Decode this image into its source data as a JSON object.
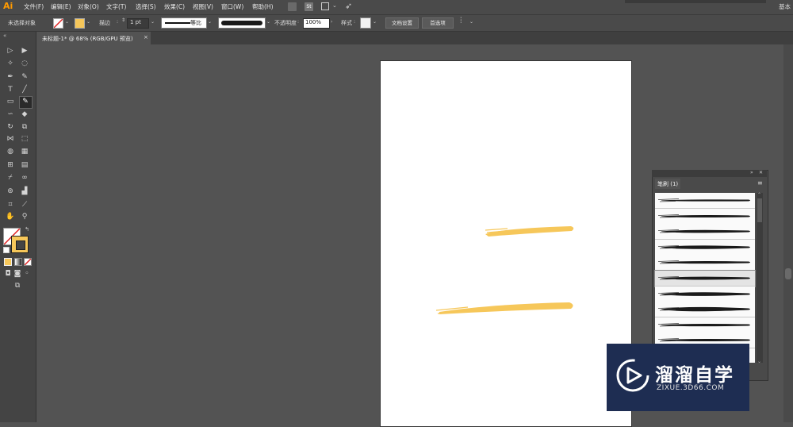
{
  "app": {
    "logo": "Ai",
    "menu": [
      "文件(F)",
      "编辑(E)",
      "对象(O)",
      "文字(T)",
      "选择(S)",
      "效果(C)",
      "视图(V)",
      "窗口(W)",
      "帮助(H)"
    ],
    "workspace_tail": "基本"
  },
  "control_bar": {
    "selection_status": "未选择对象",
    "stroke_label": "描边",
    "stroke_weight": "1 pt",
    "stroke_profile": "等比",
    "opacity_label": "不透明度",
    "opacity_value": "100%",
    "style_label": "样式",
    "doc_setup_button": "文档设置",
    "preferences_button": "首选项"
  },
  "document": {
    "tab_label": "未标题-1* @ 68% (RGB/GPU 预览)",
    "close_glyph": "×"
  },
  "brush_panel": {
    "tab_label": "笔刷 (1)",
    "brush_count": 10
  },
  "canvas": {
    "stroke_color": "#f6c75a",
    "stroke_count": 2
  },
  "watermark": {
    "title": "溜溜自学",
    "url": "ZIXUE.3D66.COM"
  },
  "colors": {
    "fill": "#f6c75a",
    "accent_logo": "#ff9a00",
    "watermark_bg": "#1e2d52"
  }
}
